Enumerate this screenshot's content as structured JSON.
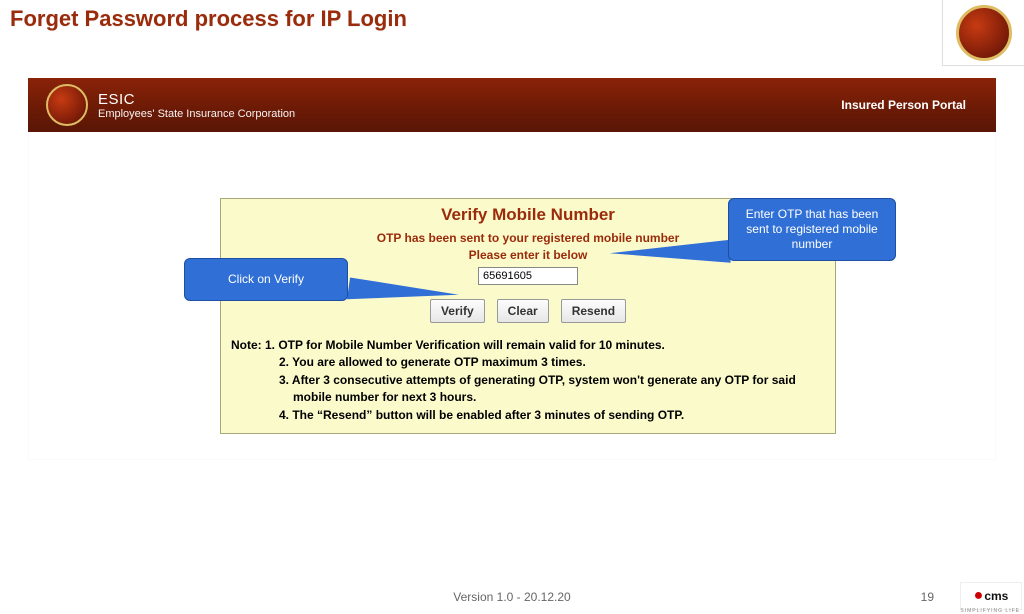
{
  "slide": {
    "title": "Forget Password process for IP Login"
  },
  "portal": {
    "brand_short": "ESIC",
    "brand_full": "Employees' State Insurance Corporation",
    "right_link": "Insured Person Portal"
  },
  "verify": {
    "heading": "Verify Mobile Number",
    "line1": "OTP has been sent to your registered mobile number",
    "line2": "Please enter it below",
    "otp_value": "65691605",
    "buttons": {
      "verify": "Verify",
      "clear": "Clear",
      "resend": "Resend"
    },
    "notes": {
      "lead": "Note: ",
      "n1": "1. OTP for Mobile Number Verification will remain valid for 10 minutes.",
      "n2": "2. You are allowed to generate OTP maximum 3 times.",
      "n3a": "3. After 3 consecutive attempts of generating OTP, system won't generate any OTP for said",
      "n3b": "mobile number for next 3 hours.",
      "n4": "4. The “Resend” button will be enabled after 3 minutes of sending OTP."
    }
  },
  "callouts": {
    "right": "Enter OTP that has been sent to registered mobile number",
    "left": "Click on Verify"
  },
  "footer": {
    "version": "Version 1.0 - 20.12.20",
    "page": "19",
    "cms_text": "cms",
    "cms_sub": "SIMPLIFYING LIFE"
  }
}
